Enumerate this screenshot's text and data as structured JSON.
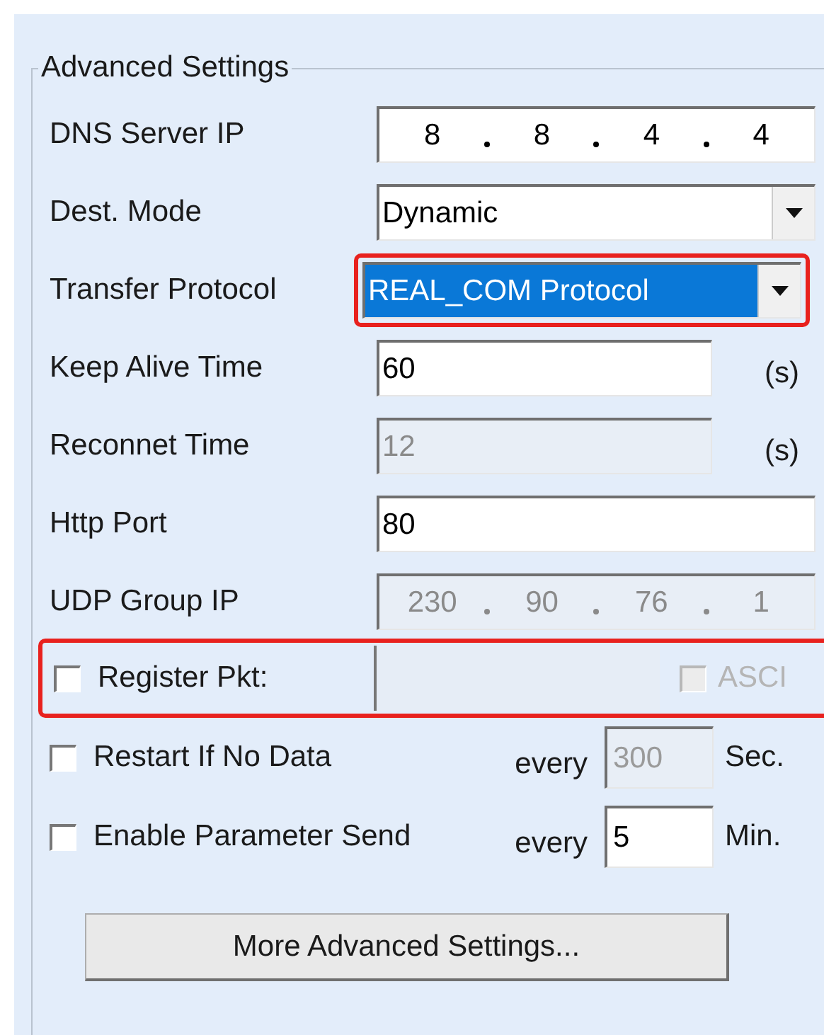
{
  "group": {
    "title": "Advanced Settings"
  },
  "fields": [
    {
      "kind": "ip",
      "label": "DNS Server IP",
      "octets": [
        "8",
        "8",
        "4",
        "4"
      ],
      "disabled": false,
      "highlighted": false
    },
    {
      "kind": "select",
      "label": "Dest. Mode",
      "value": "Dynamic",
      "focused": false,
      "highlighted": false
    },
    {
      "kind": "select",
      "label": "Transfer Protocol",
      "value": "REAL_COM Protocol",
      "focused": true,
      "highlighted": true
    },
    {
      "kind": "text",
      "label": "Keep Alive Time",
      "value": "60",
      "unit": "(s)",
      "disabled": false
    },
    {
      "kind": "text",
      "label": "Reconnet Time",
      "value": "12",
      "unit": "(s)",
      "disabled": true
    },
    {
      "kind": "text",
      "label": "Http Port",
      "value": "80",
      "disabled": false
    },
    {
      "kind": "ip",
      "label": "UDP Group IP",
      "octets": [
        "230",
        "90",
        "76",
        "1"
      ],
      "disabled": true,
      "highlighted": false
    }
  ],
  "options": [
    {
      "kind": "register",
      "label": "Register Pkt:",
      "checked": false,
      "highlighted": true,
      "field_disabled": true,
      "ascii": {
        "label": "ASCI",
        "checked": false,
        "disabled": true
      }
    },
    {
      "kind": "interval",
      "label": "Restart If No Data",
      "checked": false,
      "every": "every",
      "value": "300",
      "unit": "Sec.",
      "disabled": true
    },
    {
      "kind": "interval",
      "label": "Enable Parameter Send",
      "checked": false,
      "every": "every",
      "value": "5",
      "unit": "Min.",
      "disabled": false
    }
  ],
  "button": "More Advanced Settings..."
}
